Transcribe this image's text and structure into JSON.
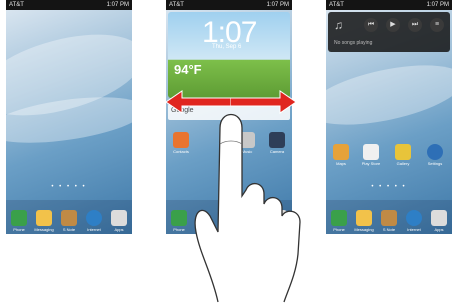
{
  "screens": [
    {
      "status": {
        "carrier": "AT&T",
        "time": "1:07 PM"
      },
      "dock": [
        {
          "icon": "phone-icon",
          "label": "Phone",
          "color": "#3aa04a"
        },
        {
          "icon": "messaging-icon",
          "label": "Messaging",
          "color": "#f2c24a"
        },
        {
          "icon": "s-note-icon",
          "label": "S Note",
          "color": "#c08a45"
        },
        {
          "icon": "internet-icon",
          "label": "Internet",
          "color": "#2e7fc6"
        },
        {
          "icon": "apps-icon",
          "label": "Apps",
          "color": "#dcdcdc"
        }
      ]
    },
    {
      "status": {
        "carrier": "AT&T",
        "time": "1:07 PM"
      },
      "clock_widget": {
        "time": "1:07",
        "date": "Thu, Sep 6",
        "temp": "94°F"
      },
      "search": {
        "label": "Google"
      },
      "apps": [
        {
          "icon": "contacts-icon",
          "label": "Contacts",
          "color": "#e8742f"
        },
        {
          "icon": "music-icon",
          "label": "Music",
          "color": "#c8c8c8"
        },
        {
          "icon": "camera-icon",
          "label": "Camera",
          "color": "#2e3e58"
        }
      ],
      "dock": [
        {
          "icon": "phone-icon",
          "label": "Phone",
          "color": "#3aa04a"
        },
        {
          "icon": "apps-icon",
          "label": "Apps",
          "color": "#dcdcdc"
        }
      ]
    },
    {
      "status": {
        "carrier": "AT&T",
        "time": "1:07 PM"
      },
      "music_widget": {
        "status": "No songs playing"
      },
      "apps": [
        {
          "icon": "maps-icon",
          "label": "Maps",
          "color": "#e6a23a"
        },
        {
          "icon": "play-store-icon",
          "label": "Play Store",
          "color": "#f0f0f0"
        },
        {
          "icon": "gallery-icon",
          "label": "Gallery",
          "color": "#e8c43a"
        },
        {
          "icon": "settings-icon",
          "label": "Settings",
          "color": "#2e6fb6"
        }
      ],
      "dock": [
        {
          "icon": "phone-icon",
          "label": "Phone",
          "color": "#3aa04a"
        },
        {
          "icon": "messaging-icon",
          "label": "Messaging",
          "color": "#f2c24a"
        },
        {
          "icon": "s-note-icon",
          "label": "S Note",
          "color": "#c08a45"
        },
        {
          "icon": "internet-icon",
          "label": "Internet",
          "color": "#2e7fc6"
        },
        {
          "icon": "apps-icon",
          "label": "Apps",
          "color": "#dcdcdc"
        }
      ]
    }
  ],
  "arrow_color": "#e0261f"
}
